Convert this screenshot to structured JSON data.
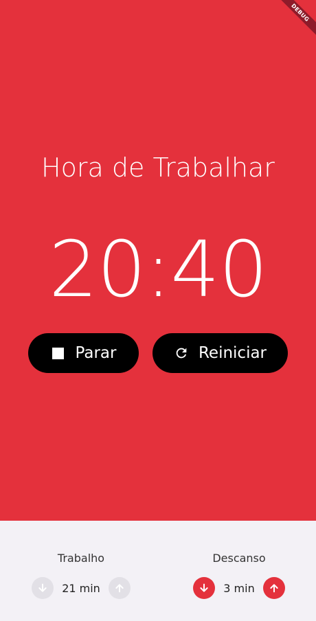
{
  "debug_banner": "DEBUG",
  "timer": {
    "mode_title": "Hora de Trabalhar",
    "time": "20:40"
  },
  "buttons": {
    "stop_label": "Parar",
    "reset_label": "Reiniciar"
  },
  "settings": {
    "work": {
      "label": "Trabalho",
      "value": "21 min",
      "enabled": false
    },
    "rest": {
      "label": "Descanso",
      "value": "3 min",
      "enabled": true
    }
  },
  "colors": {
    "accent": "#e4313c",
    "button_bg": "#000000",
    "panel_bg": "#f3f1f6",
    "disabled": "#e2e0e6"
  },
  "icons": {
    "stop": "stop-icon",
    "reset": "refresh-icon",
    "decrease": "arrow-down-icon",
    "increase": "arrow-up-icon"
  }
}
